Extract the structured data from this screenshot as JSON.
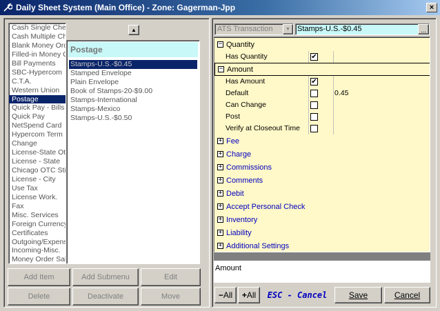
{
  "window": {
    "title": "Daily Sheet System (Main Office) - Zone: Gagerman-Jpp",
    "close_label": "×"
  },
  "categories": [
    "Cash Single Check",
    "Cash Multiple Checks",
    "Blank Money Order",
    "Filled-in Money Order",
    "Bill Payments",
    "SBC-Hypercom",
    "C.T.A.",
    "Western Union",
    "Postage",
    "Quick Pay - Bills",
    "Quick Pay",
    "NetSpend Card",
    "Hypercom Term",
    "Change",
    "License-State Other",
    "License - State",
    "Chicago OTC Sticker",
    "License - City",
    "Use Tax",
    "License Work.",
    "Fax",
    "Misc. Services",
    "Foreign Currency",
    "Certificates",
    "Outgoing/Expenses",
    "Incoming-Misc.",
    "Money Order Sale"
  ],
  "selected_category": "Postage",
  "submenu": {
    "header": "Postage",
    "items": [
      "Stamps-U.S.-$0.45",
      "Stamped Envelope",
      "Plain Envelope",
      "Book of Stamps-20-$9.00",
      "Stamps-International",
      "Stamps-Mexico",
      "Stamps-U.S.-$0.50"
    ],
    "selected": "Stamps-U.S.-$0.45"
  },
  "left_buttons": {
    "add_item": "Add Item",
    "add_submenu": "Add Submenu",
    "edit": "Edit",
    "delete": "Delete",
    "deactivate": "Deactivate",
    "move": "Move"
  },
  "transaction_type": "ATS Transaction",
  "item_name": "Stamps-U.S.-$0.45",
  "ellipsis": "...",
  "sections": {
    "quantity": {
      "label": "Quantity",
      "props": [
        {
          "name": "Has Quantity",
          "checked": true
        }
      ]
    },
    "amount": {
      "label": "Amount",
      "props": [
        {
          "name": "Has Amount",
          "checked": true,
          "value": ""
        },
        {
          "name": "Default",
          "checked": false,
          "value": "0.45"
        },
        {
          "name": "Can Change",
          "checked": false,
          "value": ""
        },
        {
          "name": "Post",
          "checked": false,
          "value": ""
        },
        {
          "name": "Verify at Closeout Time",
          "checked": false,
          "value": ""
        }
      ]
    },
    "collapsed": [
      "Fee",
      "Charge",
      "Commissions",
      "Comments",
      "Debit",
      "Accept Personal Check",
      "Inventory",
      "Liability",
      "Additional Settings"
    ]
  },
  "description": "Amount",
  "bottom_buttons": {
    "collapse_all": "All",
    "expand_all": "All",
    "esc_cancel": "ESC - Cancel",
    "save": "Save",
    "cancel": "Cancel"
  },
  "colors": {
    "section_bg": "#fff8c8",
    "highlight_cyan": "#c8f8f8",
    "selection": "#0a246a",
    "link_blue": "#0000c0"
  }
}
